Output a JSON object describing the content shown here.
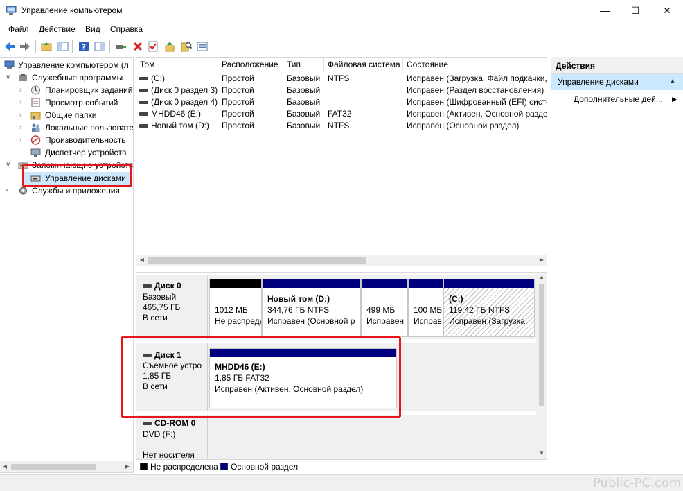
{
  "window": {
    "title": "Управление компьютером",
    "controls": {
      "minimize": "—",
      "maximize": "☐",
      "close": "✕"
    }
  },
  "menu": [
    "Файл",
    "Действие",
    "Вид",
    "Справка"
  ],
  "toolbar": {
    "icons": [
      "back-arrow-icon",
      "forward-arrow-icon",
      "up-folder-icon",
      "show-hide-tree-icon",
      "help-icon",
      "properties-pane-icon",
      "connect-icon",
      "delete-icon",
      "check-icon",
      "folder-up-icon",
      "search-icon",
      "properties-icon"
    ]
  },
  "tree": {
    "root": "Управление компьютером (л",
    "items": [
      {
        "label": "Служебные программы",
        "level": 1,
        "expander": "∨",
        "icon": "tools-icon"
      },
      {
        "label": "Планировщик заданий",
        "level": 2,
        "expander": "›",
        "icon": "clock-icon"
      },
      {
        "label": "Просмотр событий",
        "level": 2,
        "expander": "›",
        "icon": "event-viewer-icon"
      },
      {
        "label": "Общие папки",
        "level": 2,
        "expander": "›",
        "icon": "shared-folder-icon"
      },
      {
        "label": "Локальные пользовате",
        "level": 2,
        "expander": "›",
        "icon": "users-icon"
      },
      {
        "label": "Производительность",
        "level": 2,
        "expander": "›",
        "icon": "performance-icon"
      },
      {
        "label": "Диспетчер устройств",
        "level": 2,
        "expander": "",
        "icon": "device-manager-icon"
      },
      {
        "label": "Запоминающие устройства",
        "level": 1,
        "expander": "∨",
        "icon": "storage-icon"
      },
      {
        "label": "Управление дисками",
        "level": 2,
        "expander": "",
        "icon": "disk-management-icon",
        "selected": true
      },
      {
        "label": "Службы и приложения",
        "level": 1,
        "expander": "›",
        "icon": "services-icon"
      }
    ]
  },
  "volumes": {
    "columns": [
      "Том",
      "Расположение",
      "Тип",
      "Файловая система",
      "Состояние"
    ],
    "rows": [
      [
        "(C:)",
        "Простой",
        "Базовый",
        "NTFS",
        "Исправен (Загрузка, Файл подкачки, Ава"
      ],
      [
        "(Диск 0 раздел 3)",
        "Простой",
        "Базовый",
        "",
        "Исправен (Раздел восстановления)"
      ],
      [
        "(Диск 0 раздел 4)",
        "Простой",
        "Базовый",
        "",
        "Исправен (Шифрованный (EFI) систе"
      ],
      [
        "MHDD46 (E:)",
        "Простой",
        "Базовый",
        "FAT32",
        "Исправен (Активен, Основной раздел"
      ],
      [
        "Новый том (D:)",
        "Простой",
        "Базовый",
        "NTFS",
        "Исправен (Основной раздел)"
      ]
    ]
  },
  "disks": [
    {
      "name": "Диск 0",
      "type": "Базовый",
      "size": "465,75 ГБ",
      "status": "В сети",
      "partitions": [
        {
          "title": "",
          "line1": "1012 МБ",
          "line2": "Не распредел",
          "bar": "unallocated"
        },
        {
          "title": "Новый том  (D:)",
          "line1": "344,76 ГБ NTFS",
          "line2": "Исправен (Основной р",
          "bar": "primary"
        },
        {
          "title": "",
          "line1": "499 МБ",
          "line2": "Исправен",
          "bar": "primary"
        },
        {
          "title": "",
          "line1": "100 МБ",
          "line2": "Исправ",
          "bar": "primary"
        },
        {
          "title": "(C:)",
          "line1": "119,42 ГБ NTFS",
          "line2": "Исправен (Загрузка,",
          "bar": "primary",
          "hatched": true
        }
      ]
    },
    {
      "name": "Диск 1",
      "type": "Съемное устро",
      "size": "1,85 ГБ",
      "status": "В сети",
      "partitions": [
        {
          "title": "MHDD46  (E:)",
          "line1": "1,85 ГБ FAT32",
          "line2": "Исправен (Активен, Основной раздел)",
          "bar": "primary"
        }
      ]
    },
    {
      "name": "CD-ROM 0",
      "type": "DVD (F:)",
      "size": "",
      "status": "Нет носителя",
      "partitions": []
    }
  ],
  "legend": [
    {
      "label": "Не распределена",
      "color": "#000000"
    },
    {
      "label": "Основной раздел",
      "color": "#00007f"
    }
  ],
  "actions": {
    "header": "Действия",
    "section": "Управление дисками",
    "more": "Дополнительные дей..."
  },
  "colors": {
    "primary_bar": "#00007f",
    "unallocated_bar": "#000000",
    "selection": "#cce8ff",
    "highlight": "#e8161b"
  },
  "watermark": "Public-PC.com"
}
